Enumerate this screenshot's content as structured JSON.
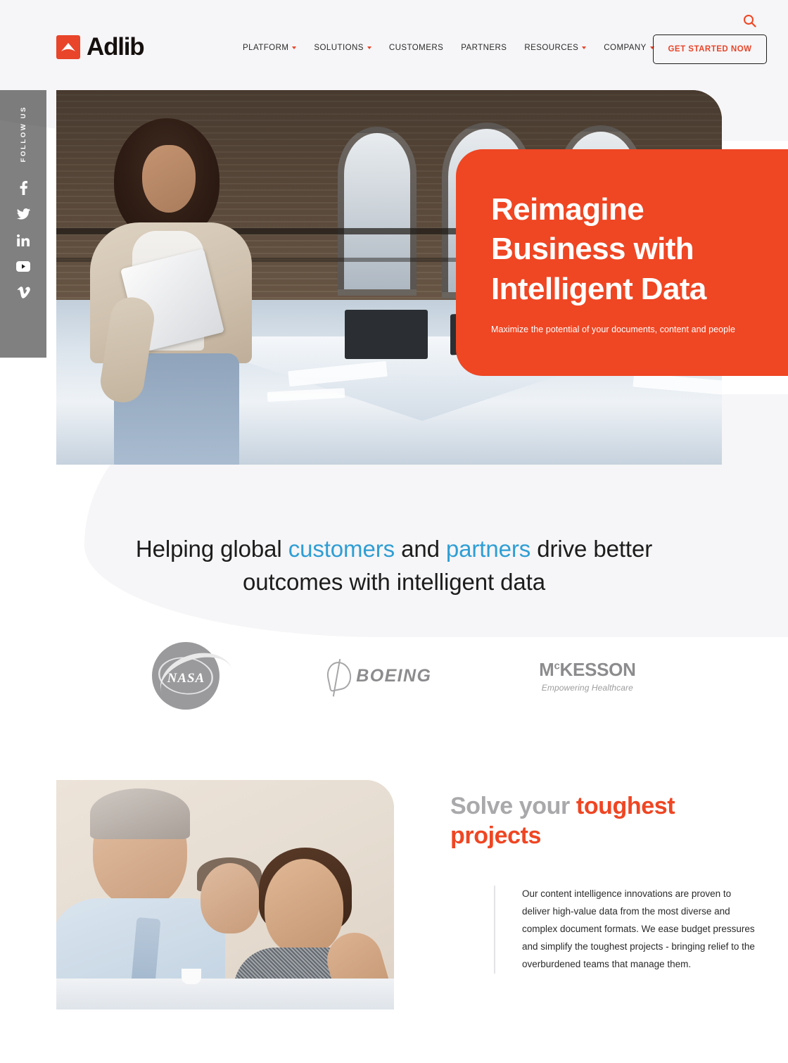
{
  "brand": {
    "name": "Adlib",
    "logo_icon": "adlib-chevron-logo",
    "accent_orange": "#ef4623",
    "accent_blue": "#2f9ed4",
    "gray": "#a9a9ab"
  },
  "header": {
    "search_icon": "search-icon",
    "nav": [
      {
        "label": "PLATFORM",
        "has_caret": true
      },
      {
        "label": "SOLUTIONS",
        "has_caret": true
      },
      {
        "label": "CUSTOMERS",
        "has_caret": false
      },
      {
        "label": "PARTNERS",
        "has_caret": false
      },
      {
        "label": "RESOURCES",
        "has_caret": true
      },
      {
        "label": "COMPANY",
        "has_caret": true
      }
    ],
    "cta_label": "GET STARTED NOW"
  },
  "social": {
    "label": "FOLLOW US",
    "items": [
      {
        "name": "facebook-icon",
        "glyph": "f"
      },
      {
        "name": "twitter-icon",
        "glyph": "t"
      },
      {
        "name": "linkedin-icon",
        "glyph": "in"
      },
      {
        "name": "youtube-icon",
        "glyph": "yt"
      },
      {
        "name": "vimeo-icon",
        "glyph": "v"
      }
    ]
  },
  "hero": {
    "title_line1": "Reimagine",
    "title_line2": "Business with",
    "title_line3": "Intelligent Data",
    "subtitle": "Maximize the potential of your documents, content and people",
    "image_alt": "woman-with-laptop-in-modern-office"
  },
  "headline": {
    "part1": "Helping global ",
    "accent1": "customers",
    "part2": " and ",
    "accent2": "partners",
    "part3": " drive better",
    "line2": "outcomes with intelligent data"
  },
  "customer_logos": [
    {
      "name": "nasa-logo",
      "text": "NASA"
    },
    {
      "name": "boeing-logo",
      "text": "BOEING"
    },
    {
      "name": "mckesson-logo",
      "text": "MCKESSON",
      "tagline": "Empowering Healthcare"
    }
  ],
  "solve": {
    "title_gray": "Solve your ",
    "title_accent": "toughest projects",
    "body": "Our content intelligence innovations are proven to deliver high-value data from the most diverse and complex document formats. We ease budget pressures and simplify the toughest projects - bringing relief to the overburdened teams that manage them.",
    "image_alt": "business-team-in-meeting"
  }
}
